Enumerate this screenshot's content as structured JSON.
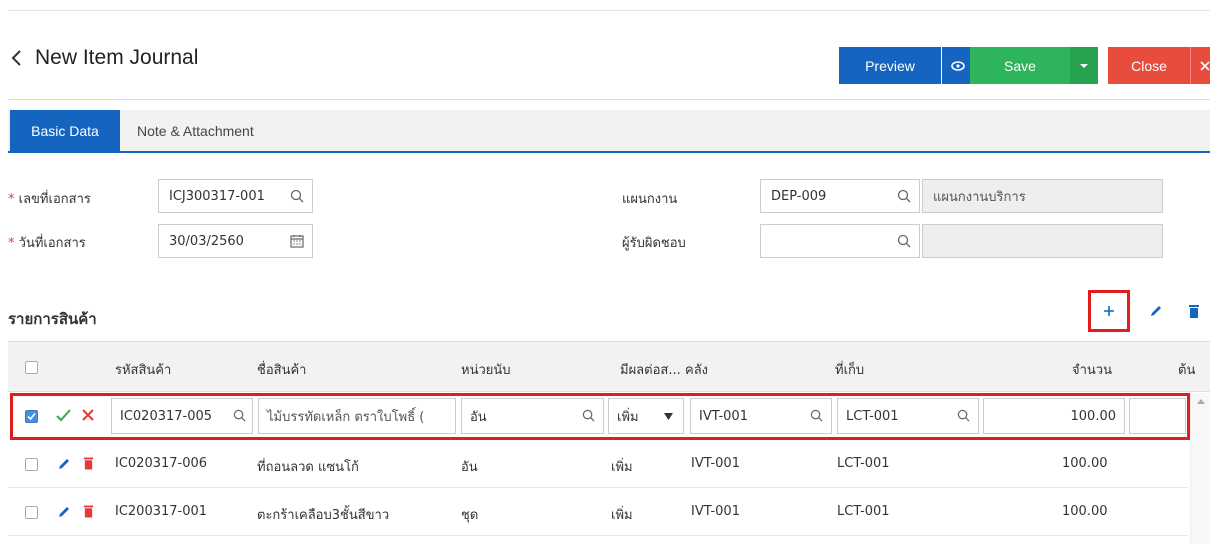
{
  "header": {
    "title": "New Item Journal",
    "preview_label": "Preview",
    "save_label": "Save",
    "close_label": "Close"
  },
  "tabs": [
    {
      "label": "Basic Data",
      "active": true
    },
    {
      "label": "Note & Attachment",
      "active": false
    }
  ],
  "form": {
    "doc_no_label": "เลขที่เอกสาร",
    "doc_no_value": "ICJ300317-001",
    "doc_date_label": "วันที่เอกสาร",
    "doc_date_value": "30/03/2560",
    "dept_label": "แผนกงาน",
    "dept_code": "DEP-009",
    "dept_name": "แผนกงานบริการ",
    "responsible_label": "ผู้รับผิดชอบ",
    "responsible_code": "",
    "responsible_name": ""
  },
  "items": {
    "section_title": "รายการสินค้า",
    "add_icon": "plus-icon",
    "columns": [
      "รหัสสินค้า",
      "ชื่อสินค้า",
      "หน่วยนับ",
      "มีผลต่อส...",
      "คลัง",
      "ที่เก็บ",
      "จำนวน",
      "ต้น"
    ],
    "edit_row": {
      "code": "IC020317-005",
      "name": "ไม้บรรทัดเหล็ก ตราใบโพธิ์ (",
      "unit": "อัน",
      "effect": "เพิ่ม",
      "warehouse": "IVT-001",
      "location": "LCT-001",
      "qty": "100.00"
    },
    "rows": [
      {
        "code": "IC020317-006",
        "name": "ที่ถอนลวด แซนโก้",
        "unit": "อัน",
        "effect": "เพิ่ม",
        "warehouse": "IVT-001",
        "location": "LCT-001",
        "qty": "100.00"
      },
      {
        "code": "IC200317-001",
        "name": "ตะกร้าเคลือบ3ชั้นสีขาว",
        "unit": "ชุด",
        "effect": "เพิ่ม",
        "warehouse": "IVT-001",
        "location": "LCT-001",
        "qty": "100.00"
      }
    ]
  },
  "colors": {
    "primary": "#1565c0",
    "save": "#2eb45a",
    "close": "#e74c3c",
    "highlight": "#e01e1e"
  }
}
